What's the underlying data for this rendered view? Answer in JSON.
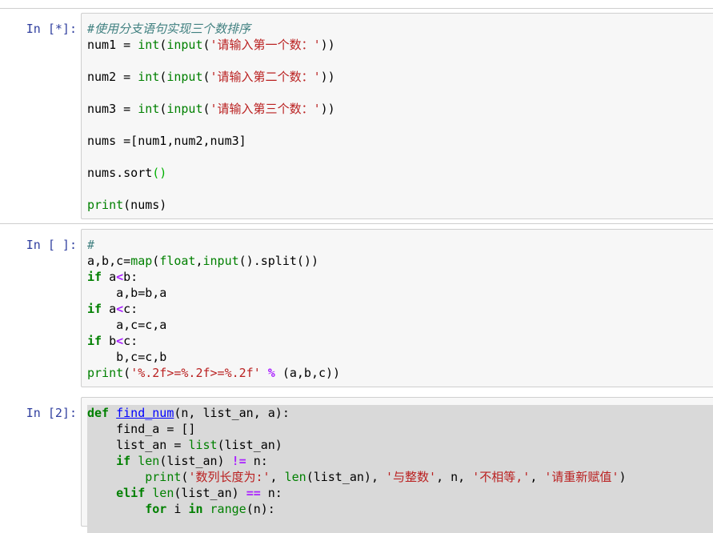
{
  "cells": [
    {
      "prompt": "In [*]:",
      "lines": [
        [
          {
            "t": "#使用分支语句实现三个数排序",
            "c": "cm"
          }
        ],
        [
          {
            "t": "num1 = "
          },
          {
            "t": "int",
            "c": "bi"
          },
          {
            "t": "("
          },
          {
            "t": "input",
            "c": "bi"
          },
          {
            "t": "("
          },
          {
            "t": "'请输入第一个数：'",
            "c": "st"
          },
          {
            "t": "))"
          }
        ],
        [],
        [
          {
            "t": "num2 = "
          },
          {
            "t": "int",
            "c": "bi"
          },
          {
            "t": "("
          },
          {
            "t": "input",
            "c": "bi"
          },
          {
            "t": "("
          },
          {
            "t": "'请输入第二个数：'",
            "c": "st"
          },
          {
            "t": "))"
          }
        ],
        [],
        [
          {
            "t": "num3 = "
          },
          {
            "t": "int",
            "c": "bi"
          },
          {
            "t": "("
          },
          {
            "t": "input",
            "c": "bi"
          },
          {
            "t": "("
          },
          {
            "t": "'请输入第三个数：'",
            "c": "st"
          },
          {
            "t": "))"
          }
        ],
        [],
        [
          {
            "t": "nums =[num1,num2,num3]"
          }
        ],
        [],
        [
          {
            "t": "nums.sort"
          },
          {
            "t": "()",
            "c": "br"
          }
        ],
        [],
        [
          {
            "t": "print",
            "c": "bi"
          },
          {
            "t": "(nums)"
          }
        ]
      ]
    },
    {
      "prompt": "In [ ]:",
      "lines": [
        [
          {
            "t": "#",
            "c": "cm"
          }
        ],
        [
          {
            "t": "a,b,c="
          },
          {
            "t": "map",
            "c": "bi"
          },
          {
            "t": "("
          },
          {
            "t": "float",
            "c": "bi"
          },
          {
            "t": ","
          },
          {
            "t": "input",
            "c": "bi"
          },
          {
            "t": "().split())"
          }
        ],
        [
          {
            "t": "if",
            "c": "kw"
          },
          {
            "t": " a"
          },
          {
            "t": "<",
            "c": "op"
          },
          {
            "t": "b:"
          }
        ],
        [
          {
            "t": "    a,b=b,a"
          }
        ],
        [
          {
            "t": "if",
            "c": "kw"
          },
          {
            "t": " a"
          },
          {
            "t": "<",
            "c": "op"
          },
          {
            "t": "c:"
          }
        ],
        [
          {
            "t": "    a,c=c,a"
          }
        ],
        [
          {
            "t": "if",
            "c": "kw"
          },
          {
            "t": " b"
          },
          {
            "t": "<",
            "c": "op"
          },
          {
            "t": "c:"
          }
        ],
        [
          {
            "t": "    b,c=c,b"
          }
        ],
        [
          {
            "t": "print",
            "c": "bi"
          },
          {
            "t": "("
          },
          {
            "t": "'%.2f>=%.2f>=%.2f'",
            "c": "st"
          },
          {
            "t": " "
          },
          {
            "t": "%",
            "c": "op"
          },
          {
            "t": " (a,b,c))"
          }
        ]
      ]
    },
    {
      "prompt": "In [2]:",
      "lines": [
        [
          {
            "t": "def",
            "c": "kw"
          },
          {
            "t": " "
          },
          {
            "t": "find_num",
            "c": "fn"
          },
          {
            "t": "(n, list_an, a):"
          }
        ],
        [
          {
            "t": "    find_a = []"
          }
        ],
        [
          {
            "t": "    list_an = "
          },
          {
            "t": "list",
            "c": "bi"
          },
          {
            "t": "(list_an)"
          }
        ],
        [
          {
            "t": "    "
          },
          {
            "t": "if",
            "c": "kw"
          },
          {
            "t": " "
          },
          {
            "t": "len",
            "c": "bi"
          },
          {
            "t": "(list_an) "
          },
          {
            "t": "!=",
            "c": "op"
          },
          {
            "t": " n:"
          }
        ],
        [
          {
            "t": "        "
          },
          {
            "t": "print",
            "c": "bi"
          },
          {
            "t": "("
          },
          {
            "t": "'数列长度为:'",
            "c": "st"
          },
          {
            "t": ", "
          },
          {
            "t": "len",
            "c": "bi"
          },
          {
            "t": "(list_an), "
          },
          {
            "t": "'与整数'",
            "c": "st"
          },
          {
            "t": ", n, "
          },
          {
            "t": "'不相等,'",
            "c": "st"
          },
          {
            "t": ", "
          },
          {
            "t": "'请重新赋值'",
            "c": "st"
          },
          {
            "t": ")"
          }
        ],
        [
          {
            "t": "    "
          },
          {
            "t": "elif",
            "c": "kw"
          },
          {
            "t": " "
          },
          {
            "t": "len",
            "c": "bi"
          },
          {
            "t": "(list_an) "
          },
          {
            "t": "==",
            "c": "op"
          },
          {
            "t": " n:"
          }
        ],
        [
          {
            "t": "        "
          },
          {
            "t": "for",
            "c": "kw"
          },
          {
            "t": " i "
          },
          {
            "t": "in",
            "c": "kw"
          },
          {
            "t": " "
          },
          {
            "t": "range",
            "c": "bi"
          },
          {
            "t": "(n):"
          }
        ]
      ]
    }
  ]
}
